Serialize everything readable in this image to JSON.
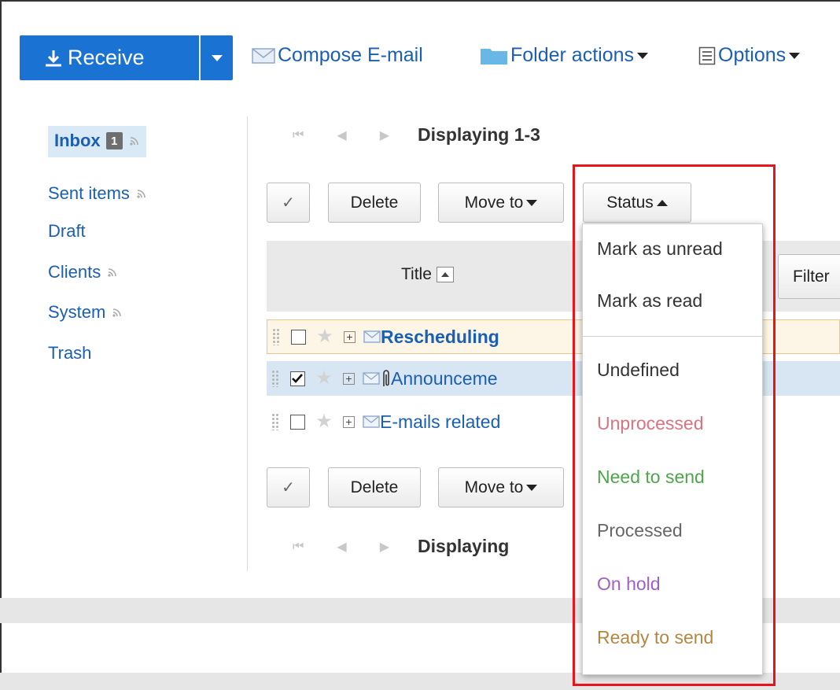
{
  "toolbar": {
    "receive_label": "Receive",
    "compose_label": "Compose E-mail",
    "folder_actions_label": "Folder actions",
    "options_label": "Options"
  },
  "sidebar": {
    "inbox": {
      "label": "Inbox",
      "unread": "1"
    },
    "items": [
      {
        "label": "Sent items",
        "rss": true
      },
      {
        "label": "Draft",
        "rss": false
      },
      {
        "label": "Clients",
        "rss": true
      },
      {
        "label": "System",
        "rss": true
      },
      {
        "label": "Trash",
        "rss": false
      }
    ]
  },
  "pager": {
    "top_text": "Displaying 1-3",
    "bottom_text": "Displaying"
  },
  "actions": {
    "delete_label": "Delete",
    "move_label": "Move to",
    "status_label": "Status"
  },
  "table": {
    "title_header": "Title",
    "filter_label": "Filter",
    "rows": [
      {
        "subject": "Rescheduling",
        "checked": false,
        "attachment": false,
        "unread": true
      },
      {
        "subject": "Announceme",
        "checked": true,
        "attachment": true,
        "unread": false
      },
      {
        "subject": "E-mails related",
        "checked": false,
        "attachment": false,
        "unread": false
      }
    ]
  },
  "status_menu": {
    "mark_unread": "Mark as unread",
    "mark_read": "Mark as read",
    "statuses": [
      {
        "label": "Undefined",
        "color": "#333333"
      },
      {
        "label": "Unprocessed",
        "color": "#d9737f"
      },
      {
        "label": "Need to send",
        "color": "#4ea64a"
      },
      {
        "label": "Processed",
        "color": "#666666"
      },
      {
        "label": "On hold",
        "color": "#a15fc2"
      },
      {
        "label": "Ready to send",
        "color": "#b38742"
      }
    ]
  },
  "colors": {
    "accent": "#1a73d2",
    "link": "#1a5fb4",
    "highlight": "#e8141b"
  }
}
